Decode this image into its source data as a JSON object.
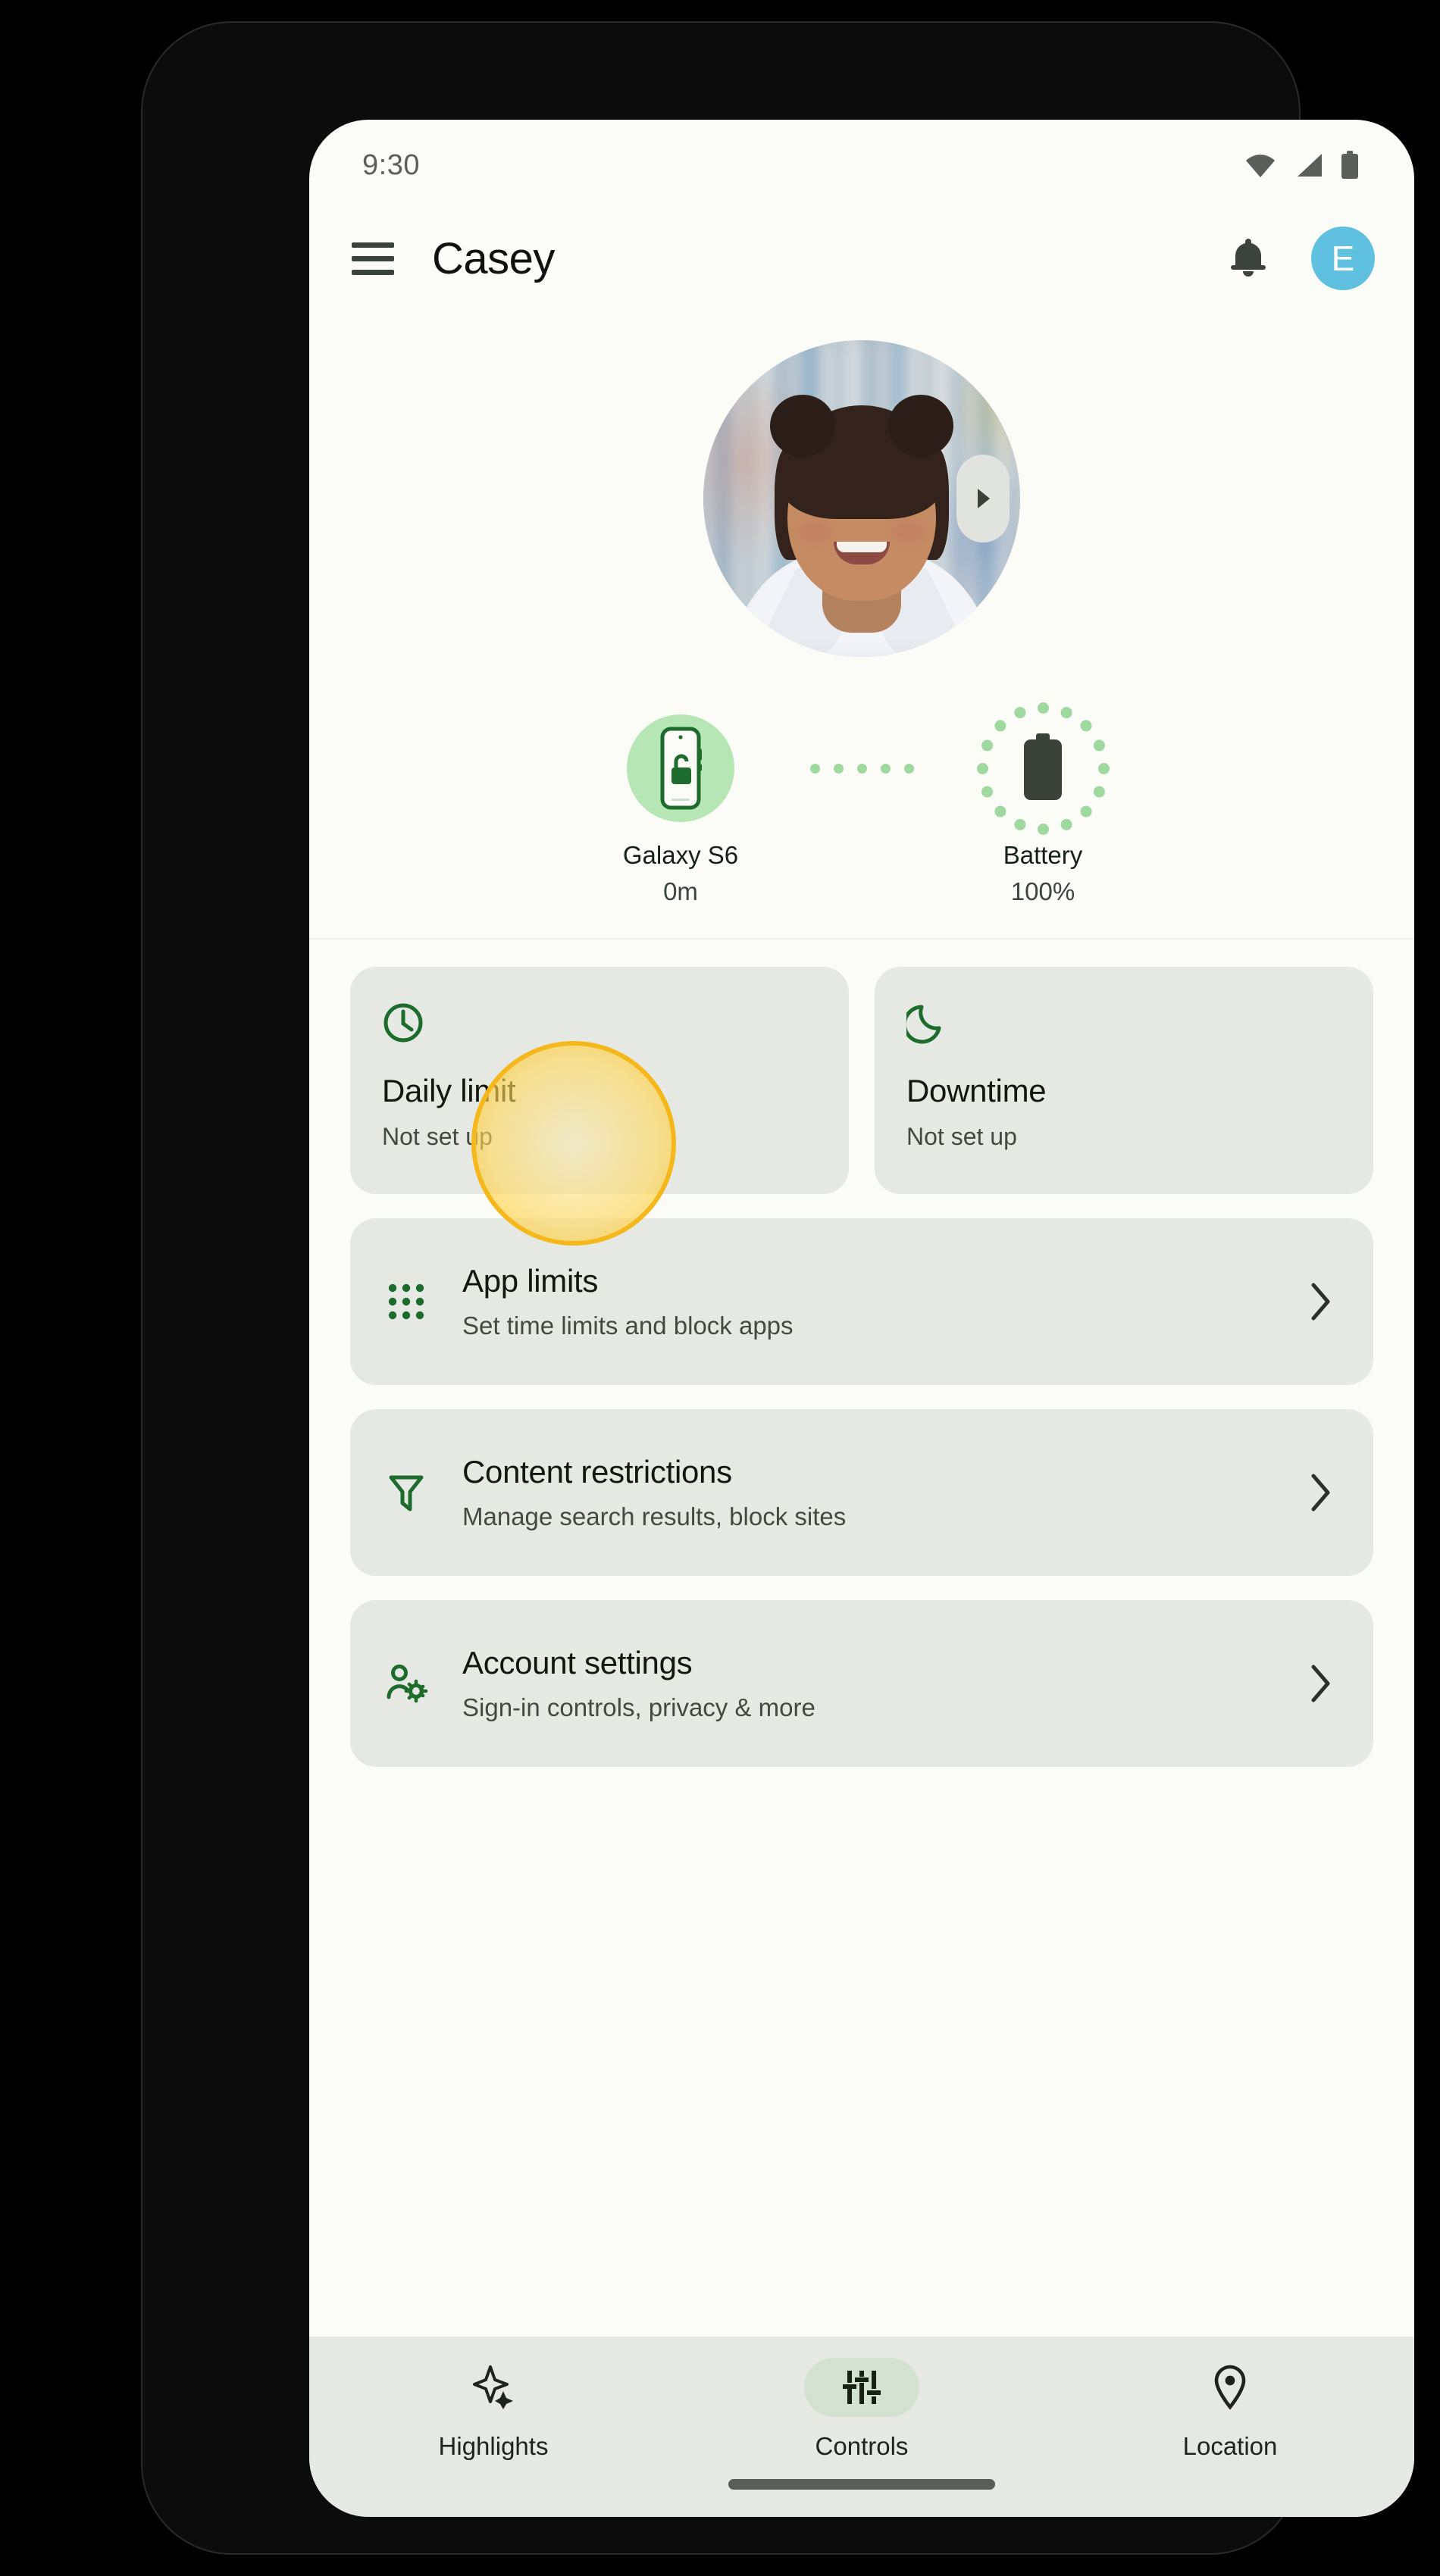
{
  "statusbar": {
    "time": "9:30",
    "icons": [
      "wifi-icon",
      "cellular-signal-icon",
      "battery-icon"
    ]
  },
  "appbar": {
    "menu_icon": "hamburger-menu-icon",
    "title": "Casey",
    "notification_icon": "bell-icon",
    "avatar_initial": "E",
    "avatar_color": "#5FC0DF"
  },
  "hero": {
    "prev_label": "◀",
    "next_label": "▶",
    "photo_alt": "child-profile-photo",
    "device": {
      "icon": "phone-unlocked-icon",
      "title": "Galaxy S6",
      "subtitle": "0m"
    },
    "battery": {
      "icon": "battery-full-icon",
      "title": "Battery",
      "subtitle": "100%"
    }
  },
  "cards": {
    "pair": [
      {
        "icon": "clock-icon",
        "title": "Daily limit",
        "subtitle": "Not set up"
      },
      {
        "icon": "moon-icon",
        "title": "Downtime",
        "subtitle": "Not set up"
      }
    ],
    "rows": [
      {
        "icon": "apps-grid-icon",
        "title": "App limits",
        "subtitle": "Set time limits and block apps",
        "chevron": "chevron-right-icon"
      },
      {
        "icon": "filter-icon",
        "title": "Content restrictions",
        "subtitle": "Manage search results, block sites",
        "chevron": "chevron-right-icon"
      },
      {
        "icon": "person-gear-icon",
        "title": "Account settings",
        "subtitle": "Sign-in controls, privacy & more",
        "chevron": "chevron-right-icon"
      }
    ]
  },
  "tap_indicator": {
    "target": "Daily limit",
    "color": "#F5B81C"
  },
  "bottomnav": {
    "items": [
      {
        "icon": "sparkle-icon",
        "label": "Highlights",
        "active": false
      },
      {
        "icon": "sliders-icon",
        "label": "Controls",
        "active": true
      },
      {
        "icon": "location-pin-icon",
        "label": "Location",
        "active": false
      }
    ],
    "active_pill_color": "#D3E2D0"
  },
  "colors": {
    "screen_bg": "#FBFBF7",
    "card_bg": "#E6E9E3",
    "accent_green": "#1E6B2E",
    "bubble_green": "#B6E6B4"
  }
}
